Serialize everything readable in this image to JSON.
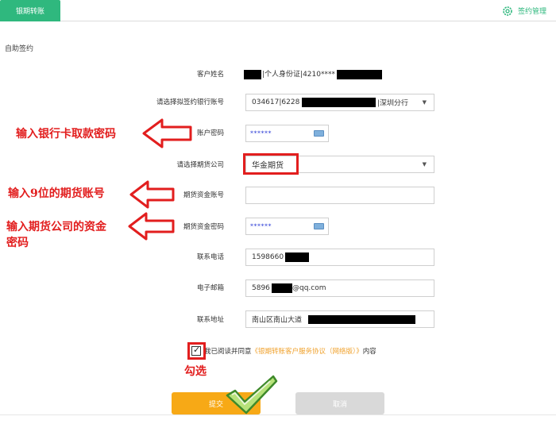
{
  "header": {
    "active_tab": "银期转账",
    "manage_label": "签约管理"
  },
  "section_title": "自助签约",
  "form": {
    "customer_name": {
      "label": "客户姓名",
      "value_a": "|个人身份证|4210****"
    },
    "bank_account": {
      "label": "请选择拟签约银行账号",
      "value_a": "034617|6228",
      "value_b": "|深圳分行"
    },
    "account_password": {
      "label": "账户密码",
      "value": "******"
    },
    "futures_company": {
      "label": "请选择期货公司",
      "value": "华金期货"
    },
    "futures_account": {
      "label": "期货资金账号",
      "value": ""
    },
    "futures_password": {
      "label": "期货资金密码",
      "value": "******"
    },
    "phone": {
      "label": "联系电话",
      "value": "1598660"
    },
    "email": {
      "label": "电子邮箱",
      "value_a": "5896",
      "value_b": "@qq.com"
    },
    "address": {
      "label": "联系地址",
      "value": "南山区南山大道"
    }
  },
  "agreement": {
    "prefix": "我已阅读并同意",
    "link": "《银期转账客户服务协议（网络版）》",
    "suffix": "内容"
  },
  "buttons": {
    "submit": "提交",
    "cancel": "取消"
  },
  "annotations": {
    "bank_password": "输入银行卡取款密码",
    "futures_account": "输入9位的期货账号",
    "futures_password_line1": "输入期货公司的资金",
    "futures_password_line2": "密码",
    "check": "勾选"
  },
  "colors": {
    "accent_green": "#2fb87e",
    "annotation_red": "#e21e1e",
    "submit_orange": "#f7a916",
    "link_orange": "#f0a22e"
  }
}
